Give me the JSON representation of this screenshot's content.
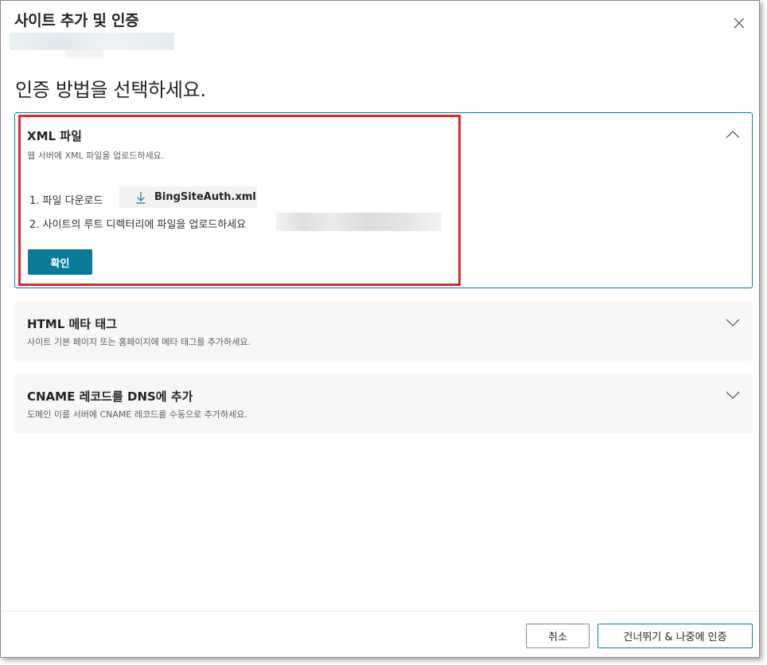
{
  "dialog": {
    "title": "사이트 추가 및 인증",
    "heading": "인증 방법을 선택하세요."
  },
  "methods": [
    {
      "title": "XML 파일",
      "description": "웹 서버에 XML 파일을 업로드하세요.",
      "expanded": true,
      "steps": {
        "step1_label": "1. 파일 다운로드",
        "download_file": "BingSiteAuth.xml",
        "step2_label": "2. 사이트의 루트 디렉터리에 파일을 업로드하세요"
      },
      "confirm_label": "확인"
    },
    {
      "title": "HTML 메타 태그",
      "description": "사이트 기본 페이지 또는 홈페이지에 메타 태그를 추가하세요.",
      "expanded": false
    },
    {
      "title": "CNAME 레코드를 DNS에 추가",
      "description": "도메인 이름 서버에 CNAME 레코드를 수동으로 추가하세요.",
      "expanded": false
    }
  ],
  "footer": {
    "cancel_label": "취소",
    "skip_label": "건너뛰기 & 나중에 인증"
  },
  "colors": {
    "accent": "#0b7a99",
    "highlight": "#e0272f",
    "collapsed_panel_bg": "#f8f7f6"
  },
  "icons": {
    "close": "close-icon",
    "download": "download-icon",
    "expanded": "chevron-up-icon",
    "collapsed": "chevron-down-icon"
  }
}
